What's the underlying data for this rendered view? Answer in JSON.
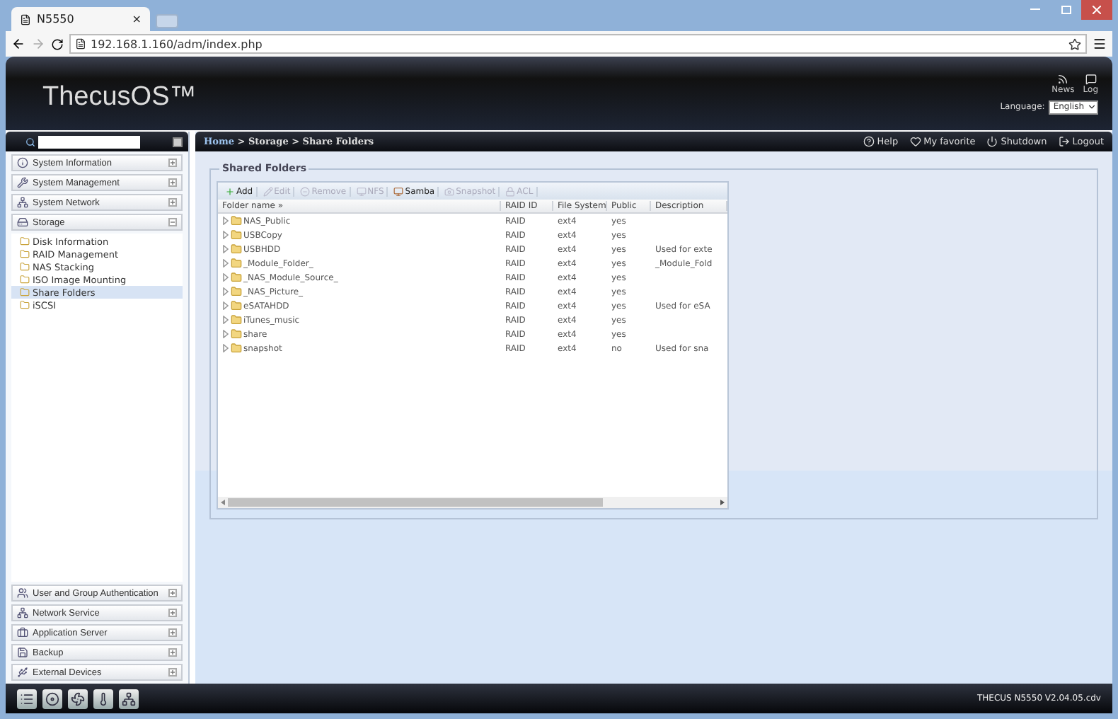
{
  "browser": {
    "tab": {
      "title": "N5550",
      "close": "×"
    },
    "url": "192.168.1.160/adm/index.php"
  },
  "header": {
    "logo": "ThecusOS™",
    "links": [
      {
        "kind": "news",
        "label": "News"
      },
      {
        "kind": "log",
        "label": "Log"
      }
    ],
    "language": {
      "label": "Language:",
      "value": "English"
    }
  },
  "sidebar": {
    "groups": [
      {
        "kind": "info",
        "label": "System Information",
        "expanded": false
      },
      {
        "kind": "tools",
        "label": "System Management",
        "expanded": false
      },
      {
        "kind": "network",
        "label": "System Network",
        "expanded": false
      },
      {
        "kind": "storage",
        "label": "Storage",
        "expanded": true,
        "items": [
          {
            "label": "Disk Information",
            "selected": false
          },
          {
            "label": "RAID Management",
            "selected": false
          },
          {
            "label": "NAS Stacking",
            "selected": false
          },
          {
            "label": "ISO Image Mounting",
            "selected": false
          },
          {
            "label": "Share Folders",
            "selected": true
          },
          {
            "label": "iSCSI",
            "selected": false
          }
        ]
      },
      {
        "kind": "users",
        "label": "User and Group Authentication",
        "expanded": false
      },
      {
        "kind": "network",
        "label": "Network Service",
        "expanded": false
      },
      {
        "kind": "app",
        "label": "Application Server",
        "expanded": false
      },
      {
        "kind": "backup",
        "label": "Backup",
        "expanded": false
      },
      {
        "kind": "devices",
        "label": "External Devices",
        "expanded": false
      }
    ]
  },
  "breadcrumb": {
    "home": "Home",
    "path": "> Storage > Share Folders"
  },
  "top_actions": [
    {
      "kind": "help",
      "label": "Help"
    },
    {
      "kind": "favorite",
      "label": "My favorite"
    },
    {
      "kind": "shutdown",
      "label": "Shutdown"
    },
    {
      "kind": "logout",
      "label": "Logout"
    }
  ],
  "panel": {
    "title": "Shared Folders",
    "toolbar": [
      {
        "kind": "add",
        "label": "Add",
        "disabled": false
      },
      {
        "kind": "edit",
        "label": "Edit",
        "disabled": true
      },
      {
        "kind": "remove",
        "label": "Remove",
        "disabled": true
      },
      {
        "kind": "nfs",
        "label": "NFS",
        "disabled": true
      },
      {
        "kind": "samba",
        "label": "Samba",
        "disabled": false
      },
      {
        "kind": "snapshot",
        "label": "Snapshot",
        "disabled": true
      },
      {
        "kind": "acl",
        "label": "ACL",
        "disabled": true
      }
    ],
    "columns": [
      "Folder name »",
      "RAID ID",
      "File System",
      "Public",
      "Description"
    ],
    "rows": [
      [
        "NAS_Public",
        "RAID",
        "ext4",
        "yes",
        ""
      ],
      [
        "USBCopy",
        "RAID",
        "ext4",
        "yes",
        ""
      ],
      [
        "USBHDD",
        "RAID",
        "ext4",
        "yes",
        "Used for exte"
      ],
      [
        "_Module_Folder_",
        "RAID",
        "ext4",
        "yes",
        "_Module_Fold"
      ],
      [
        "_NAS_Module_Source_",
        "RAID",
        "ext4",
        "yes",
        ""
      ],
      [
        "_NAS_Picture_",
        "RAID",
        "ext4",
        "yes",
        ""
      ],
      [
        "eSATAHDD",
        "RAID",
        "ext4",
        "yes",
        "Used for eSA"
      ],
      [
        "iTunes_music",
        "RAID",
        "ext4",
        "yes",
        ""
      ],
      [
        "share",
        "RAID",
        "ext4",
        "yes",
        ""
      ],
      [
        "snapshot",
        "RAID",
        "ext4",
        "no",
        "Used for sna"
      ]
    ]
  },
  "footer": {
    "buttons": [
      {
        "kind": "list"
      },
      {
        "kind": "disk"
      },
      {
        "kind": "fan"
      },
      {
        "kind": "temperature"
      },
      {
        "kind": "network"
      }
    ],
    "version": "THECUS N5550 V2.04.05.cdv"
  }
}
